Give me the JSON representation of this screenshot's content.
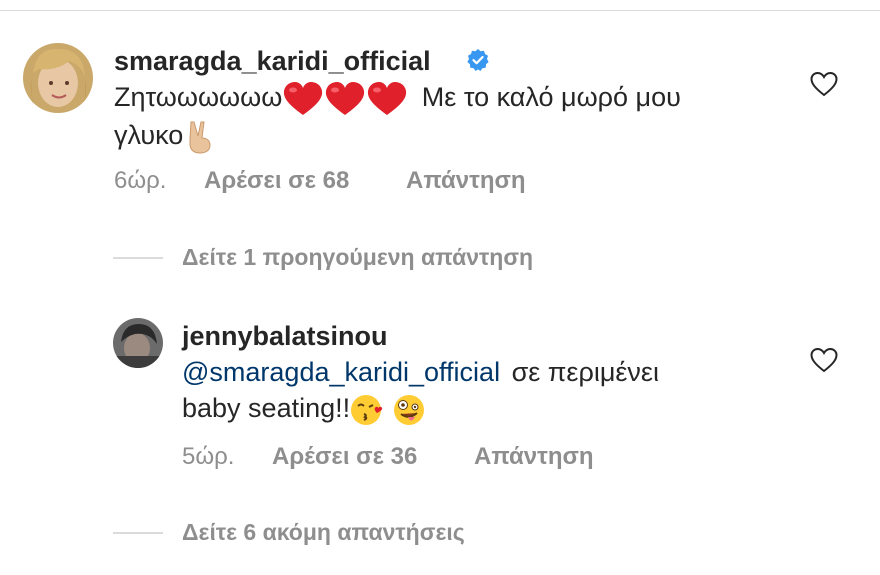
{
  "comments": [
    {
      "username": "smaragda_karidi_official",
      "verified": true,
      "line1_text": "Ζητωωωωωω",
      "line1_suffix": "Με το καλό μωρό μου",
      "line2_text": "γλυκο",
      "emojis": [
        "red-heart",
        "red-heart",
        "red-heart",
        "victory-hand"
      ],
      "time": "6ώρ.",
      "likes": "Αρέσει σε 68",
      "reply": "Απάντηση"
    },
    {
      "username": "jennybalatsinou",
      "mention": "@smaragda_karidi_official",
      "line1_suffix": "σε περιμένει",
      "line2_text": "baby seating!!",
      "emojis": [
        "face-blowing-kiss",
        "zany-face"
      ],
      "time": "5ώρ.",
      "likes": "Αρέσει σε 36",
      "reply": "Απάντηση"
    }
  ],
  "view_previous": "Δείτε 1 προηγούμενη απάντηση",
  "view_more": "Δείτε 6 ακόμη απαντήσεις",
  "icons": {
    "like": "heart-outline-icon",
    "verified": "verified-badge-icon"
  },
  "colors": {
    "verified": "#3897f0",
    "mention": "#00376b",
    "muted": "#8e8e8e",
    "heart": "#e0202b"
  }
}
